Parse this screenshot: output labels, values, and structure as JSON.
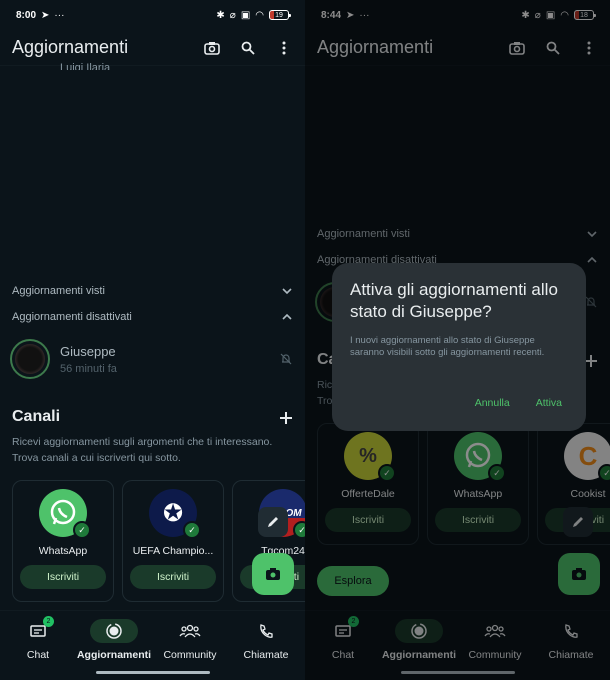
{
  "screens": [
    {
      "status": {
        "time": "8:00",
        "battery": "19"
      },
      "appbar": {
        "title": "Aggiornamenti"
      },
      "peek_name": "Luigi Ilaria",
      "sections": {
        "seen": "Aggiornamenti visti",
        "muted": "Aggiornamenti disattivati"
      },
      "contact": {
        "name": "Giuseppe",
        "time": "56 minuti fa"
      },
      "channels": {
        "title": "Canali",
        "description": "Ricevi aggiornamenti sugli argomenti che ti interessano. Trova canali a cui iscriverti qui sotto.",
        "items": [
          {
            "name": "WhatsApp",
            "button": "Iscriviti"
          },
          {
            "name": "UEFA Champio...",
            "button": "Iscriviti"
          },
          {
            "name": "Tgcom24",
            "button": "Iscriviti",
            "logo_text": "TGCOM"
          }
        ]
      }
    },
    {
      "status": {
        "time": "8:44",
        "battery": "18"
      },
      "appbar": {
        "title": "Aggiornamenti"
      },
      "sections": {
        "seen": "Aggiornamenti visti",
        "muted": "Aggiornamenti disattivati"
      },
      "channels": {
        "title": "Canali",
        "description": "Ricevi aggiornamenti sugli argomenti che ti interessano. Trova canali a cui iscriverti qui sotto.",
        "items": [
          {
            "name": "OfferteDale",
            "button": "Iscriviti"
          },
          {
            "name": "WhatsApp",
            "button": "Iscriviti"
          },
          {
            "name": "Cookist",
            "button": "Iscriviti"
          }
        ]
      },
      "explore": "Esplora",
      "dialog": {
        "title": "Attiva gli aggiornamenti allo stato di Giuseppe?",
        "body": "I nuovi aggiornamenti allo stato di Giuseppe saranno visibili sotto gli aggiornamenti recenti.",
        "cancel": "Annulla",
        "confirm": "Attiva"
      }
    }
  ],
  "nav": {
    "items": [
      {
        "label": "Chat",
        "badge": "2"
      },
      {
        "label": "Aggiornamenti"
      },
      {
        "label": "Community"
      },
      {
        "label": "Chiamate"
      }
    ]
  },
  "colors": {
    "accent": "#4ec26a",
    "background": "#0b141a",
    "dialog": "#2a3136"
  }
}
